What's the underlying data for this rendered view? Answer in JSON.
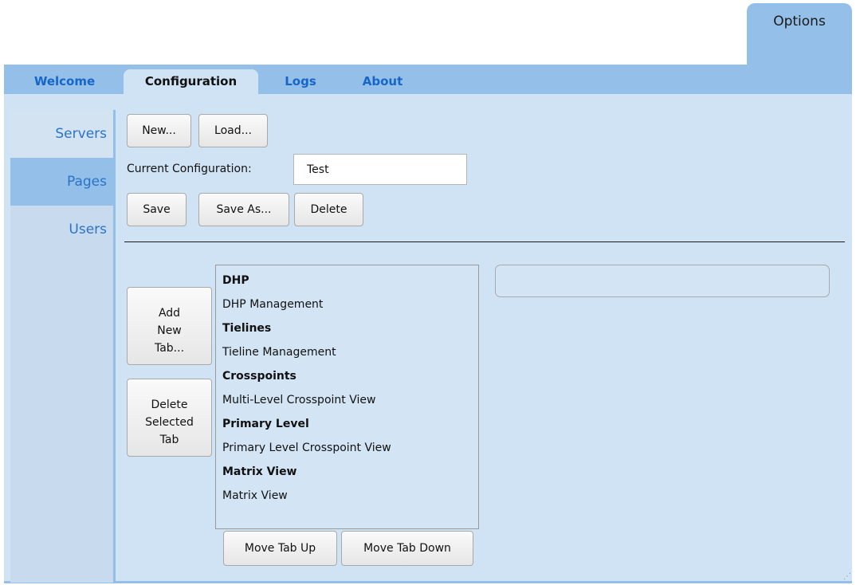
{
  "options_tab": {
    "label": "Options"
  },
  "top_tabs": [
    {
      "label": "Welcome"
    },
    {
      "label": "Configuration",
      "active": true
    },
    {
      "label": "Logs"
    },
    {
      "label": "About"
    }
  ],
  "left_nav": [
    {
      "label": "Servers"
    },
    {
      "label": "Pages",
      "active": true
    },
    {
      "label": "Users"
    }
  ],
  "config": {
    "new_label": "New...",
    "load_label": "Load...",
    "current_label": "Current Configuration:",
    "current_value": "Test",
    "save_label": "Save",
    "save_as_label": "Save As...",
    "delete_label": "Delete"
  },
  "tab_actions": {
    "add_lines": [
      "Add",
      "New",
      "Tab..."
    ],
    "delete_lines": [
      "Delete",
      "Selected",
      "Tab"
    ]
  },
  "tab_list": [
    {
      "label": "DHP",
      "kind": "group"
    },
    {
      "label": "DHP Management",
      "kind": "page"
    },
    {
      "label": "Tielines",
      "kind": "group"
    },
    {
      "label": "Tieline Management",
      "kind": "page"
    },
    {
      "label": "Crosspoints",
      "kind": "group"
    },
    {
      "label": "Multi-Level Crosspoint View",
      "kind": "page"
    },
    {
      "label": "Primary Level",
      "kind": "group"
    },
    {
      "label": "Primary Level Crosspoint View",
      "kind": "page"
    },
    {
      "label": "Matrix View",
      "kind": "group"
    },
    {
      "label": "Matrix View",
      "kind": "page"
    }
  ],
  "move": {
    "up_label": "Move Tab Up",
    "down_label": "Move Tab Down"
  },
  "detail": {
    "value": ""
  },
  "colors": {
    "tab_bar": "#93bfe9",
    "panel": "#d0e3f5",
    "link_blue": "#1666c9"
  }
}
